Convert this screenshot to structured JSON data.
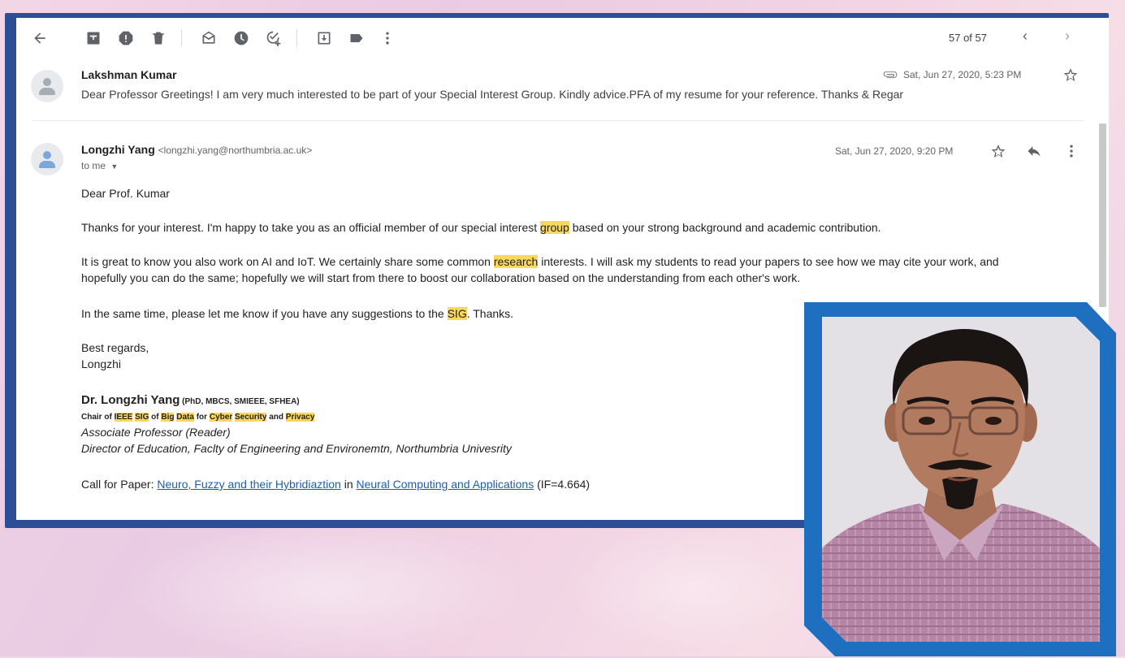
{
  "toolbar": {
    "icons": [
      "back-arrow-icon",
      "archive-icon",
      "report-spam-icon",
      "delete-icon",
      "mark-unread-icon",
      "snooze-icon",
      "add-task-icon",
      "move-to-icon",
      "label-icon",
      "more-vert-icon"
    ],
    "pager": "57 of 57",
    "prev": "‹",
    "next": "›"
  },
  "message1": {
    "sender": "Lakshman Kumar",
    "date": "Sat, Jun 27, 2020, 5:23 PM",
    "snippet": "Dear Professor Greetings! I am very much interested to be part of your Special Interest Group. Kindly advice.PFA of my resume for your reference. Thanks & Regar"
  },
  "message2": {
    "sender": "Longzhi Yang",
    "address": "<longzhi.yang@northumbria.ac.uk>",
    "date": "Sat, Jun 27, 2020, 9:20 PM",
    "to": "to me",
    "greeting": "Dear Prof. Kumar",
    "p1_a": "Thanks for your interest. I'm happy to take you as an official member of our special interest ",
    "p1_hl": "group",
    "p1_b": " based on your strong background and academic contribution.",
    "p2_a": "It is great to know you also work on AI and IoT. We certainly share some common ",
    "p2_hl": "research",
    "p2_b": " interests. I will ask my students to read your papers to see how we may cite your work, and",
    "p2_c": "hopefully you can do the same; hopefully we will start from there to boost our collaboration based on the understanding from each other's work.",
    "p3_a": "In the same time, please let me know if you have any suggestions to the ",
    "p3_hl": "SIG",
    "p3_b": ". Thanks.",
    "closing": "Best regards,",
    "closing_name": "Longzhi",
    "sig_name": "Dr. Longzhi Yang",
    "sig_cred": " (PhD, MBCS, SMIEEE, SFHEA)",
    "chair": {
      "t1": "Chair of ",
      "h1": "IEEE",
      "t2": " ",
      "h2": "SIG",
      "t3": " of ",
      "h3": "Big",
      "t4": " ",
      "h4": "Data",
      "t5": " for ",
      "h5": "Cyber",
      "t6": " ",
      "h6": "Security",
      "t7": " and ",
      "h7": "Privacy"
    },
    "title1": "Associate Professor (Reader)",
    "title2": "Director of Education, Faclty of Engineering and Environemtn, Northumbria Univesrity",
    "cfp_label": "Call for Paper: ",
    "cfp_link1": "Neuro, Fuzzy and their Hybridiaztion",
    "cfp_in": " in ",
    "cfp_link2": "Neural Computing and Applications",
    "cfp_if": " (IF=4.664)"
  }
}
